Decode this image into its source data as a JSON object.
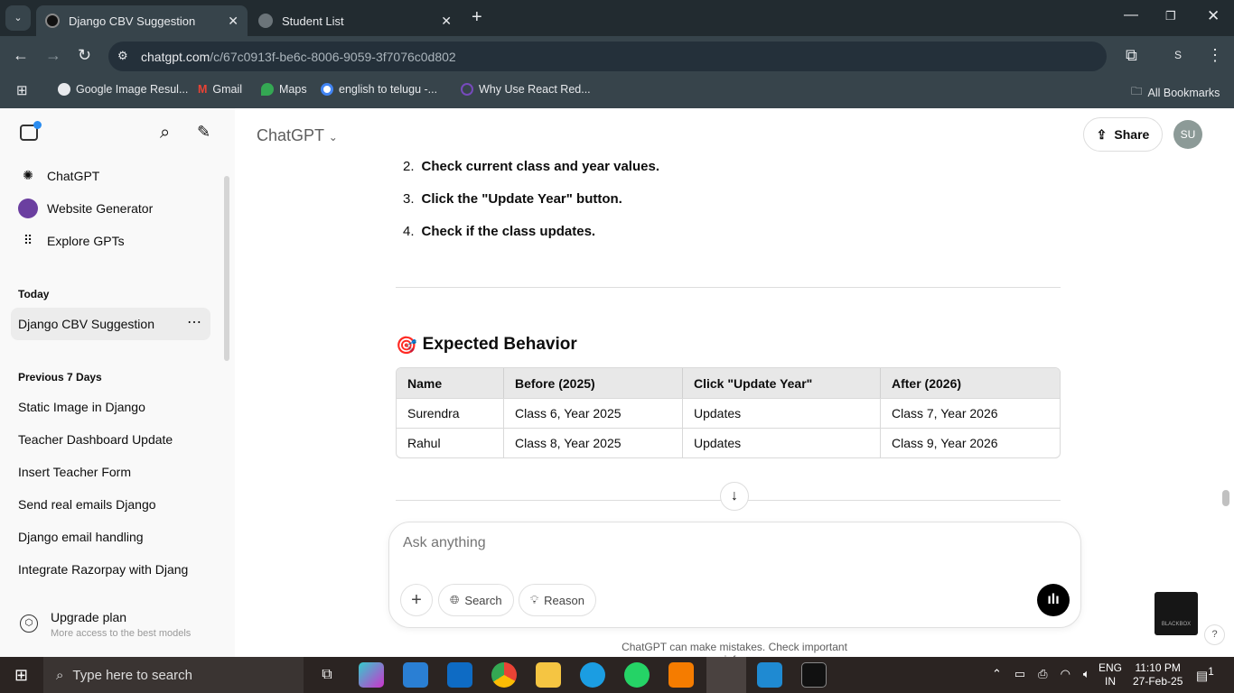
{
  "browser": {
    "tabs": [
      {
        "title": "Django CBV Suggestion",
        "active": true
      },
      {
        "title": "Student List",
        "active": false
      }
    ],
    "url_host": "chatgpt.com",
    "url_path": "/c/67c0913f-be6c-8006-9059-3f7076c0d802",
    "profile": "S",
    "bookmarks": [
      "Google Image Resul...",
      "Gmail",
      "Maps",
      "english to telugu -...",
      "Why Use React Red..."
    ],
    "all_bookmarks": "All Bookmarks"
  },
  "sidebar": {
    "nav": [
      "ChatGPT",
      "Website Generator",
      "Explore GPTs"
    ],
    "today_label": "Today",
    "today": [
      "Django CBV Suggestion"
    ],
    "prev_label": "Previous 7 Days",
    "prev": [
      "Static Image in Django",
      "Teacher Dashboard Update",
      "Insert Teacher Form",
      "Send real emails Django",
      "Django email handling",
      "Integrate Razorpay with Django"
    ],
    "upgrade": "Upgrade plan",
    "upgrade_sub": "More access to the best models"
  },
  "header": {
    "model": "ChatGPT",
    "share": "Share",
    "avatar": "SU"
  },
  "content": {
    "steps": [
      {
        "n": "2.",
        "text": "Check current class and year values."
      },
      {
        "n": "3.",
        "text": "Click the \"Update Year\" button."
      },
      {
        "n": "4.",
        "text": "Check if the class updates."
      }
    ],
    "heading_emoji": "🎯",
    "heading": "Expected Behavior",
    "table": {
      "headers": [
        "Name",
        "Before (2025)",
        "Click \"Update Year\"",
        "After (2026)"
      ],
      "rows": [
        [
          "Surendra",
          "Class 6, Year 2025",
          "Updates",
          "Class 7, Year 2026"
        ],
        [
          "Rahul",
          "Class 8, Year 2025",
          "Updates",
          "Class 9, Year 2026"
        ]
      ]
    }
  },
  "composer": {
    "placeholder": "Ask anything",
    "search": "Search",
    "reason": "Reason"
  },
  "disclaimer": "ChatGPT can make mistakes. Check important info.",
  "blackbox": "BLACKBOX",
  "taskbar": {
    "search": "Type here to search",
    "lang1": "ENG",
    "lang2": "IN",
    "time": "11:10 PM",
    "date": "27-Feb-25",
    "notifications": "1"
  }
}
